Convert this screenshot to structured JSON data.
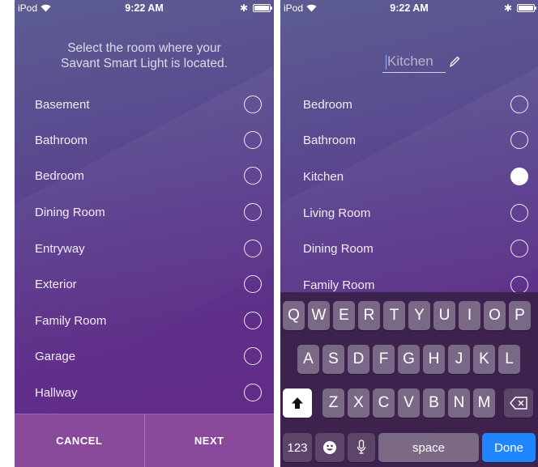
{
  "status_bar": {
    "carrier": "iPod",
    "time": "9:22 AM"
  },
  "left_screen": {
    "prompt": "Select the room where your Savant Smart Light is located.",
    "rooms": [
      {
        "label": "Basement",
        "selected": false
      },
      {
        "label": "Bathroom",
        "selected": false
      },
      {
        "label": "Bedroom",
        "selected": false
      },
      {
        "label": "Dining Room",
        "selected": false
      },
      {
        "label": "Entryway",
        "selected": false
      },
      {
        "label": "Exterior",
        "selected": false
      },
      {
        "label": "Family Room",
        "selected": false
      },
      {
        "label": "Garage",
        "selected": false
      },
      {
        "label": "Hallway",
        "selected": false
      }
    ],
    "cancel_label": "CANCEL",
    "next_label": "NEXT"
  },
  "right_screen": {
    "room_name_placeholder": "Kitchen",
    "rooms": [
      {
        "label": "Bedroom",
        "selected": false
      },
      {
        "label": "Bathroom",
        "selected": false
      },
      {
        "label": "Kitchen",
        "selected": true
      },
      {
        "label": "Living Room",
        "selected": false
      },
      {
        "label": "Dining Room",
        "selected": false
      },
      {
        "label": "Family Room",
        "selected": false
      }
    ]
  },
  "keyboard": {
    "row1": [
      "Q",
      "W",
      "E",
      "R",
      "T",
      "Y",
      "U",
      "I",
      "O",
      "P"
    ],
    "row2": [
      "A",
      "S",
      "D",
      "F",
      "G",
      "H",
      "J",
      "K",
      "L"
    ],
    "row3": [
      "Z",
      "X",
      "C",
      "V",
      "B",
      "N",
      "M"
    ],
    "numbers_label": "123",
    "space_label": "space",
    "done_label": "Done"
  },
  "colors": {
    "bottom_bar": "#8a4a9c",
    "done_key": "#1f86ff",
    "background_top": "#5d5d92",
    "background_bottom": "#632887"
  },
  "icons": [
    "wifi-icon",
    "bluetooth-icon",
    "battery-icon",
    "pencil-icon",
    "shift-icon",
    "backspace-icon",
    "emoji-icon",
    "microphone-icon"
  ]
}
